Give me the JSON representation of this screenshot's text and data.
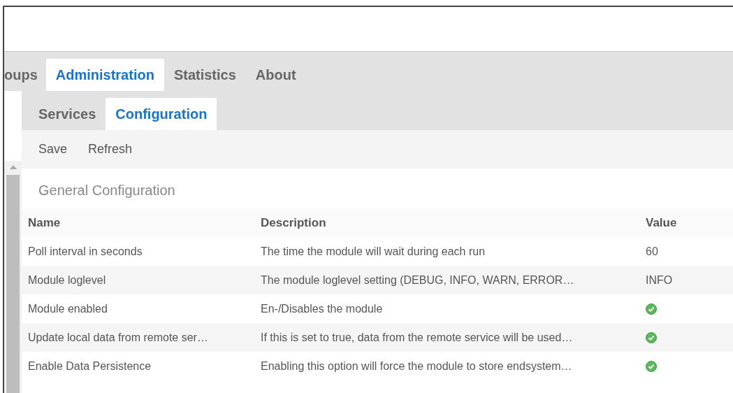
{
  "main_tabs": [
    {
      "label": "oups",
      "selected": false
    },
    {
      "label": "Administration",
      "selected": true
    },
    {
      "label": "Statistics",
      "selected": false
    },
    {
      "label": "About",
      "selected": false
    }
  ],
  "sub_tabs": [
    {
      "label": "Services",
      "selected": false
    },
    {
      "label": "Configuration",
      "selected": true
    }
  ],
  "toolbar": [
    "Save",
    "Refresh"
  ],
  "section_title": "General Configuration",
  "table": {
    "columns": [
      "Name",
      "Description",
      "Value"
    ],
    "rows": [
      {
        "name": "Poll interval in seconds",
        "description": "The time the module will wait during each run",
        "value": {
          "kind": "text",
          "text": "60"
        }
      },
      {
        "name": "Module loglevel",
        "description": "The module loglevel setting (DEBUG, INFO, WARN, ERROR…",
        "value": {
          "kind": "text",
          "text": "INFO"
        }
      },
      {
        "name": "Module enabled",
        "description": "En-/Disables the module",
        "value": {
          "kind": "check",
          "checked": true
        }
      },
      {
        "name": "Update local data from remote ser…",
        "description": "If this is set to true, data from the remote service will be used…",
        "value": {
          "kind": "check",
          "checked": true
        }
      },
      {
        "name": "Enable Data Persistence",
        "description": "Enabling this option will force the module to store endsystem…",
        "value": {
          "kind": "check",
          "checked": true
        }
      }
    ]
  }
}
